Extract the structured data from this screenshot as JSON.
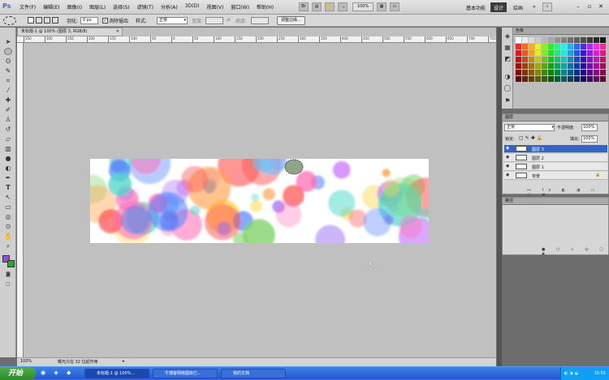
{
  "app": {
    "logo": "Ps"
  },
  "menus": [
    "文件(F)",
    "编辑(E)",
    "图像(I)",
    "图层(L)",
    "选择(S)",
    "滤镜(T)",
    "分析(A)",
    "3D(D)",
    "视图(V)",
    "窗口(W)",
    "帮助(H)"
  ],
  "zoom_menu": "100%",
  "workspaces": {
    "basic": "基本功能",
    "design": "设计",
    "painting": "绘画"
  },
  "window_buttons": {
    "minimize": "–",
    "restore": "▫",
    "close": "✕"
  },
  "options": {
    "feather_label": "羽化:",
    "feather_value": "0 px",
    "antialias": "消除锯齿",
    "style_label": "样式:",
    "style_value": "正常",
    "width_label": "宽度:",
    "height_label": "高度:",
    "refine_edge": "调整边缘..."
  },
  "document": {
    "tab_title": "未标题-1 @ 100% (图层 3, RGB/8)"
  },
  "ruler_ticks": [
    "350",
    "300",
    "250",
    "200",
    "150",
    "100",
    "50",
    "0",
    "50",
    "100",
    "150",
    "200",
    "250",
    "300",
    "350",
    "400",
    "450",
    "500",
    "550",
    "600",
    "650",
    "700",
    "750"
  ],
  "status": {
    "zoom": "100%",
    "info": "曝光只在 32 位起作用"
  },
  "panels": {
    "swatches_title": "色板",
    "layers_tab": "图层",
    "blend_mode": "正常",
    "opacity_label": "不透明度:",
    "opacity_value": "100%",
    "lock_label": "锁定:",
    "fill_label": "填充:",
    "fill_value": "100%",
    "paths_tab": "路径"
  },
  "layers": [
    {
      "name": "图层 3",
      "selected": true
    },
    {
      "name": "图层 2",
      "selected": false
    },
    {
      "name": "图层 1",
      "selected": false
    },
    {
      "name": "背景",
      "selected": false
    }
  ],
  "taskbar": {
    "start": "开始",
    "tasks": [
      "未标题-1 @ 100%...",
      "牛博客网络图库已...",
      "我的文档"
    ],
    "clock": "15:55"
  },
  "colors": {
    "selection": "#3167c4",
    "foreground": "#9a4fd1",
    "background": "#22aa33"
  }
}
